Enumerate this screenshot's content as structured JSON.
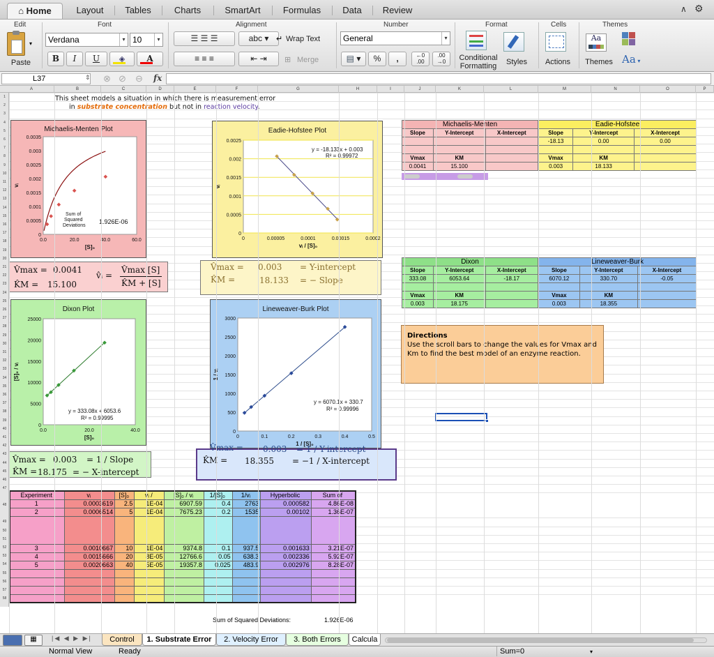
{
  "ribbon": {
    "tabs": [
      "Home",
      "Layout",
      "Tables",
      "Charts",
      "SmartArt",
      "Formulas",
      "Data",
      "Review"
    ],
    "groups": [
      "Edit",
      "Font",
      "Alignment",
      "Number",
      "Format",
      "Cells",
      "Themes"
    ],
    "paste": "Paste",
    "font_name": "Verdana",
    "font_size": "10",
    "wrap_text": "Wrap Text",
    "merge": "Merge",
    "number_format": "General",
    "cond_fmt_1": "Conditional",
    "cond_fmt_2": "Formatting",
    "styles": "Styles",
    "actions": "Actions",
    "themes": "Themes",
    "bold": "B",
    "italic": "I",
    "underline": "U",
    "font_color": "A",
    "percent": "%",
    "comma": ",",
    "abc": "abc",
    "aa": "Aa"
  },
  "formula_bar": {
    "cell_ref": "L37",
    "fx": "fx",
    "value": ""
  },
  "columns": [
    "A",
    "B",
    "C",
    "D",
    "E",
    "F",
    "G",
    "H",
    "I",
    "J",
    "K",
    "L",
    "M",
    "N",
    "O",
    "P"
  ],
  "rows": [
    "1",
    "2",
    "3",
    "4",
    "5",
    "6",
    "7",
    "8",
    "9",
    "10",
    "11",
    "12",
    "13",
    "14",
    "15",
    "16",
    "17",
    "18",
    "19",
    "20",
    "21",
    "22",
    "23",
    "24",
    "25",
    "26",
    "27",
    "28",
    "29",
    "30",
    "31",
    "32",
    "33",
    "34",
    "35",
    "36",
    "37",
    "38",
    "39",
    "40",
    "41",
    "42",
    "43",
    "44",
    "45",
    "46",
    "47",
    "48",
    "49",
    "50",
    "51",
    "52",
    "53",
    "54",
    "55",
    "56",
    "57",
    "58"
  ],
  "intro": {
    "line1": "This sheet models a situation in which there is measurement error",
    "line2_a": "in ",
    "line2_b": "substrate concentration",
    "line2_c": " but not in ",
    "line2_d": "reaction velocity",
    "line2_e": "."
  },
  "mm_chart": {
    "title": "Michaelis-Menten Plot",
    "ylabel": "vᵢ",
    "xlabel": "[S]₀",
    "yticks": [
      "0.0035",
      "0.003",
      "0.0025",
      "0.002",
      "0.0015",
      "0.001",
      "0.0005",
      "0"
    ],
    "xticks": [
      "0.0",
      "20.0",
      "40.0",
      "60.0"
    ],
    "ssd_label_1": "Sum of",
    "ssd_label_2": "Squared",
    "ssd_label_3": "Deviations",
    "ssd_value": "1.926E-06"
  },
  "eh_chart": {
    "title": "Eadie-Hofstee Plot",
    "ylabel": "vᵢ",
    "xlabel": "vᵢ / [S]₀",
    "yticks": [
      "0.0025",
      "0.002",
      "0.0015",
      "0.001",
      "0.0005",
      "0"
    ],
    "xticks": [
      "0",
      "0.00005",
      "0.0001",
      "0.00015",
      "0.0002"
    ],
    "trend1": "y = -18.133x + 0.003",
    "trend2": "R² = 0.99972"
  },
  "dx_chart": {
    "title": "Dixon Plot",
    "ylabel": "[S]₀ / vᵢ",
    "xlabel": "[S]₀",
    "yticks": [
      "25000",
      "20000",
      "15000",
      "10000",
      "5000",
      "0"
    ],
    "xticks": [
      "0.0",
      "20.0",
      "40.0"
    ],
    "trend1": "y = 333.08x + 6053.6",
    "trend2": "R² = 0.99995"
  },
  "lb_chart": {
    "title": "Lineweaver-Burk Plot",
    "ylabel": "1 / vᵢ",
    "xlabel": "1 / [S]₀",
    "yticks": [
      "3000",
      "2500",
      "2000",
      "1500",
      "1000",
      "500",
      "0"
    ],
    "xticks": [
      "0",
      "0.1",
      "0.2",
      "0.3",
      "0.4",
      "0.5"
    ],
    "trend1": "y = 6070.1x + 330.7",
    "trend2": "R² = 0.99996"
  },
  "chart_data": [
    {
      "type": "scatter",
      "title": "Michaelis-Menten Plot",
      "xlabel": "[S]₀",
      "ylabel": "vᵢ",
      "xlim": [
        0,
        60
      ],
      "ylim": [
        0,
        0.0035
      ],
      "series": [
        {
          "values": [
            [
              2.5,
              0.0003619
            ],
            [
              5,
              0.0006514
            ],
            [
              10,
              0.0010667
            ],
            [
              20,
              0.0015666
            ],
            [
              40,
              0.0020663
            ]
          ]
        }
      ],
      "curve": {
        "vmax": 0.0041,
        "km": 15.1,
        "xmax": 40
      }
    },
    {
      "type": "scatter",
      "title": "Eadie-Hofstee Plot",
      "xlabel": "vᵢ / [S]₀",
      "ylabel": "vᵢ",
      "xlim": [
        0,
        0.0002
      ],
      "ylim": [
        0,
        0.0025
      ],
      "series": [
        {
          "values": [
            [
              5.17e-05,
              0.0020663
            ],
            [
              7.83e-05,
              0.0015666
            ],
            [
              0.0001067,
              0.0010667
            ],
            [
              0.0001302,
              0.0006514
            ],
            [
              0.0001448,
              0.0003619
            ]
          ]
        }
      ],
      "trend": {
        "slope": -18.133,
        "intercept": 0.003
      }
    },
    {
      "type": "scatter",
      "title": "Dixon Plot",
      "xlabel": "[S]₀",
      "ylabel": "[S]₀ / vᵢ",
      "xlim": [
        0,
        60
      ],
      "ylim": [
        0,
        25000
      ],
      "series": [
        {
          "values": [
            [
              2.5,
              6907.59
            ],
            [
              5,
              7675.23
            ],
            [
              10,
              9374.8
            ],
            [
              20,
              12766.6
            ],
            [
              40,
              19357.8
            ]
          ]
        }
      ],
      "trend": {
        "slope": 333.08,
        "intercept": 6053.6
      }
    },
    {
      "type": "scatter",
      "title": "Lineweaver-Burk Plot",
      "xlabel": "1 / [S]₀",
      "ylabel": "1 / vᵢ",
      "xlim": [
        0,
        0.5
      ],
      "ylim": [
        0,
        3000
      ],
      "series": [
        {
          "values": [
            [
              0.025,
              483.9
            ],
            [
              0.05,
              638.3
            ],
            [
              0.1,
              937.5
            ],
            [
              0.2,
              1535
            ],
            [
              0.4,
              2763
            ]
          ]
        }
      ],
      "trend": {
        "slope": 6070.1,
        "intercept": 330.7
      }
    }
  ],
  "mm_eq": {
    "vmax_label": "V̂max =",
    "vmax": "0.0041",
    "km_label": "K̂M =",
    "km": "15.100",
    "formula_v": "v̂ᵢ =",
    "formula_num": "V̂max [S]",
    "formula_den": "K̂M + [S]"
  },
  "eh_eq": {
    "vmax_label": "V̂max =",
    "vmax": "0.003",
    "vmax_rel": "= Y-intercept",
    "km_label": "K̂M =",
    "km": "18.133",
    "km_rel": "= − Slope"
  },
  "dx_eq": {
    "vmax_label": "V̂max =",
    "vmax": "0.003",
    "vmax_rel": "= 1 / Slope",
    "km_label": "K̂M =",
    "km": "18.175",
    "km_rel": "= − X-intercept"
  },
  "lb_eq": {
    "vmax_label": "V̂max =",
    "vmax": "0.003",
    "vmax_rel": "= 1 / Y-intercept",
    "km_label": "K̂M =",
    "km": "18.355",
    "km_rel": "= −1 / X-intercept"
  },
  "param_tables": {
    "mm": {
      "name": "Michaelis-Menten",
      "h1": "Slope",
      "h2": "Y-Intercept",
      "h3": "X-Intercept",
      "v1": "",
      "v2": "",
      "v3": "",
      "vmax_h": "Vmax",
      "km_h": "KM",
      "vmax": "0.0041",
      "km": "15.100"
    },
    "eh": {
      "name": "Eadie-Hofstee",
      "h1": "Slope",
      "h2": "Y-Intercept",
      "h3": "X-Intercept",
      "v1": "-18.13",
      "v2": "0.00",
      "v3": "0.00",
      "vmax_h": "Vmax",
      "km_h": "KM",
      "vmax": "0.003",
      "km": "18.133"
    },
    "dx": {
      "name": "Dixon",
      "h1": "Slope",
      "h2": "Y-Intercept",
      "h3": "X-Intercept",
      "v1": "333.08",
      "v2": "6053.64",
      "v3": "-18.17",
      "vmax_h": "Vmax",
      "km_h": "KM",
      "vmax": "0.003",
      "km": "18.175"
    },
    "lb": {
      "name": "Lineweaver-Burk",
      "h1": "Slope",
      "h2": "Y-Intercept",
      "h3": "X-Intercept",
      "v1": "6070.12",
      "v2": "330.70",
      "v3": "-0.05",
      "vmax_h": "Vmax",
      "km_h": "KM",
      "vmax": "0.003",
      "km": "18.355"
    }
  },
  "directions": {
    "title": "Directions",
    "body": "Use the scroll bars to change the values for Vmax and Km to find the best model of an enzyme reaction."
  },
  "data_table": {
    "headers": [
      "Experiment",
      "vᵢ",
      "[S]₀",
      "vᵢ /",
      "[S]₀ / vᵢ",
      "1/[S]₀",
      "1/vᵢ",
      "Hyperbolic",
      "Sum of"
    ],
    "rows": [
      [
        "1",
        "0.0003619",
        "2.5",
        "1E-04",
        "6907.59",
        "0.4",
        "2763",
        "0.000582",
        "4.86E-08"
      ],
      [
        "2",
        "0.0006514",
        "5",
        "1E-04",
        "7675.23",
        "0.2",
        "1535",
        "0.00102",
        "1.36E-07"
      ],
      [
        "3",
        "0.0010667",
        "10",
        "1E-04",
        "9374.8",
        "0.1",
        "937.5",
        "0.001633",
        "3.21E-07"
      ],
      [
        "4",
        "0.0015666",
        "20",
        "8E-05",
        "12766.6",
        "0.05",
        "638.3",
        "0.002336",
        "5.92E-07"
      ],
      [
        "5",
        "0.0020663",
        "40",
        "5E-05",
        "19357.8",
        "0.025",
        "483.9",
        "0.002976",
        "8.28E-07"
      ]
    ],
    "ssd_label": "Sum of Squared Deviations:",
    "ssd_value": "1.926E-06"
  },
  "sheet_tabs": [
    "Control",
    "1. Substrate Error",
    "2. Velocity Error",
    "3. Both Errors",
    "Calcula"
  ],
  "status": {
    "view": "Normal View",
    "state": "Ready",
    "sum": "Sum=0"
  }
}
